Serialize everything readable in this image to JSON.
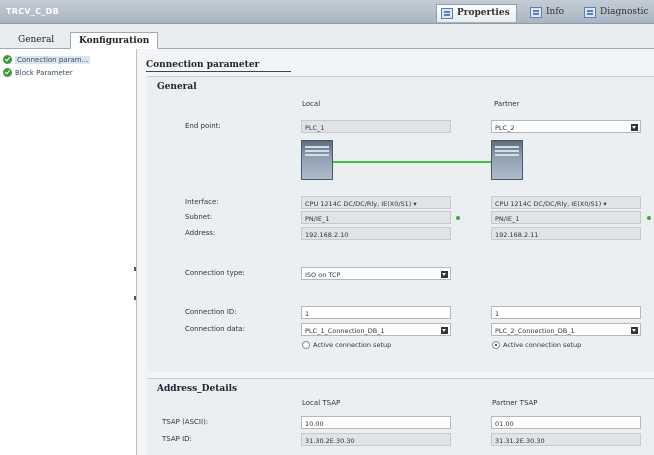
{
  "window": {
    "title": "TRCV_C_DB",
    "tabs": [
      {
        "label": "Properties",
        "icon": "properties-icon",
        "active": true
      },
      {
        "label": "Info",
        "icon": "info-icon",
        "active": false
      },
      {
        "label": "Diagnostic",
        "icon": "diagnostics-icon",
        "active": false
      }
    ]
  },
  "subtabs": [
    {
      "label": "General",
      "active": false
    },
    {
      "label": "Konfiguration",
      "active": true
    }
  ],
  "nav": [
    {
      "label": "Connection param...",
      "icon": "check-circle-icon",
      "selected": true
    },
    {
      "label": "Block Parameter",
      "icon": "check-circle-icon",
      "selected": false
    }
  ],
  "connection": {
    "header": "Connection parameter",
    "general": {
      "header": "General",
      "col_local": "Local",
      "col_partner": "Partner",
      "end_point": {
        "label": "End point:",
        "local": "PLC_1",
        "partner": "PLC_2"
      },
      "interface": {
        "label": "Interface:",
        "local": "CPU 1214C DC/DC/Rly, IE(X0/S1) ▾",
        "partner": "CPU 1214C DC/DC/Rly, IE(X0/S1) ▾"
      },
      "subnet": {
        "label": "Subnet:",
        "local": "PN/IE_1",
        "partner": "PN/IE_1"
      },
      "address": {
        "label": "Address:",
        "local": "192.168.2.10",
        "partner": "192.168.2.11"
      },
      "connection_type": {
        "label": "Connection type:",
        "value": "ISO on TCP"
      },
      "connection_id": {
        "label": "Connection ID:",
        "local": "1",
        "partner": "1"
      },
      "connection_data": {
        "label": "Connection data:",
        "local": "PLC_1_Connection_DB_1",
        "partner": "PLC_2_Connection_DB_1"
      },
      "active_setup": {
        "local": "Active connection setup",
        "partner": "Active connection setup",
        "local_selected": false,
        "partner_selected": true
      }
    },
    "address_details": {
      "header": "Address_Details",
      "col_local": "Local TSAP",
      "col_partner": "Partner TSAP",
      "tsap_ascii": {
        "label": "TSAP (ASCII):",
        "local": "10.00",
        "partner": "01.00"
      },
      "tsap_id": {
        "label": "TSAP ID:",
        "local": "31.30.2E.30.30",
        "partner": "31.31.2E.30.30"
      }
    }
  },
  "colors": {
    "link": "#3ec03e",
    "check": "#3a9a3a",
    "accent": "#5b7fb2"
  }
}
